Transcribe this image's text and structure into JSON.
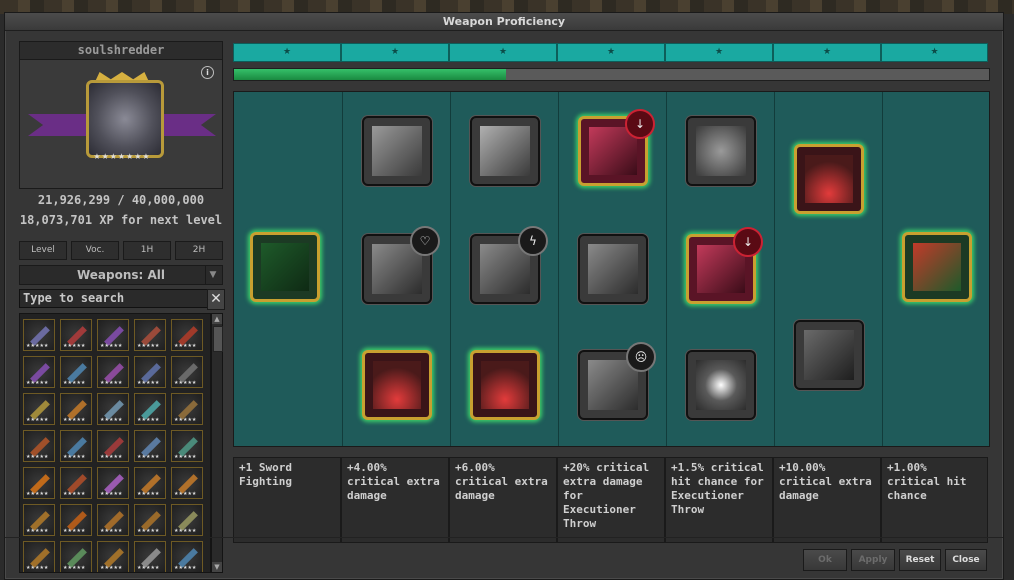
{
  "window": {
    "title": "Weapon Proficiency"
  },
  "character": {
    "name": "soulshredder",
    "xp_progress": "21,926,299 / 40,000,000",
    "xp_next": "18,073,701 XP for next level",
    "info_icon": "info-icon"
  },
  "filters": [
    {
      "label": "Level"
    },
    {
      "label": "Voc."
    },
    {
      "label": "1H"
    },
    {
      "label": "2H"
    }
  ],
  "weapon_filter": {
    "selected": "Weapons: All"
  },
  "search": {
    "placeholder": "Type to search"
  },
  "proficiency": {
    "progress_fraction": 0.36,
    "tiers": 7
  },
  "perks": [
    {
      "desc": "+1 Sword Fighting"
    },
    {
      "desc": "+4.00% critical extra damage"
    },
    {
      "desc": "+6.00% critical extra damage"
    },
    {
      "desc": "+20% critical extra damage for Executioner Throw"
    },
    {
      "desc": "+1.5% critical hit chance for Executioner Throw"
    },
    {
      "desc": "+10.00% critical extra damage"
    },
    {
      "desc": "+1.00% critical hit chance"
    }
  ],
  "buttons": {
    "ok": "Ok",
    "apply": "Apply",
    "reset": "Reset",
    "close": "Close"
  },
  "colors": {
    "teal": "#1aa9a1",
    "gold": "#c8a030",
    "glow": "#3cd06a",
    "red": "#9a1a2c"
  }
}
